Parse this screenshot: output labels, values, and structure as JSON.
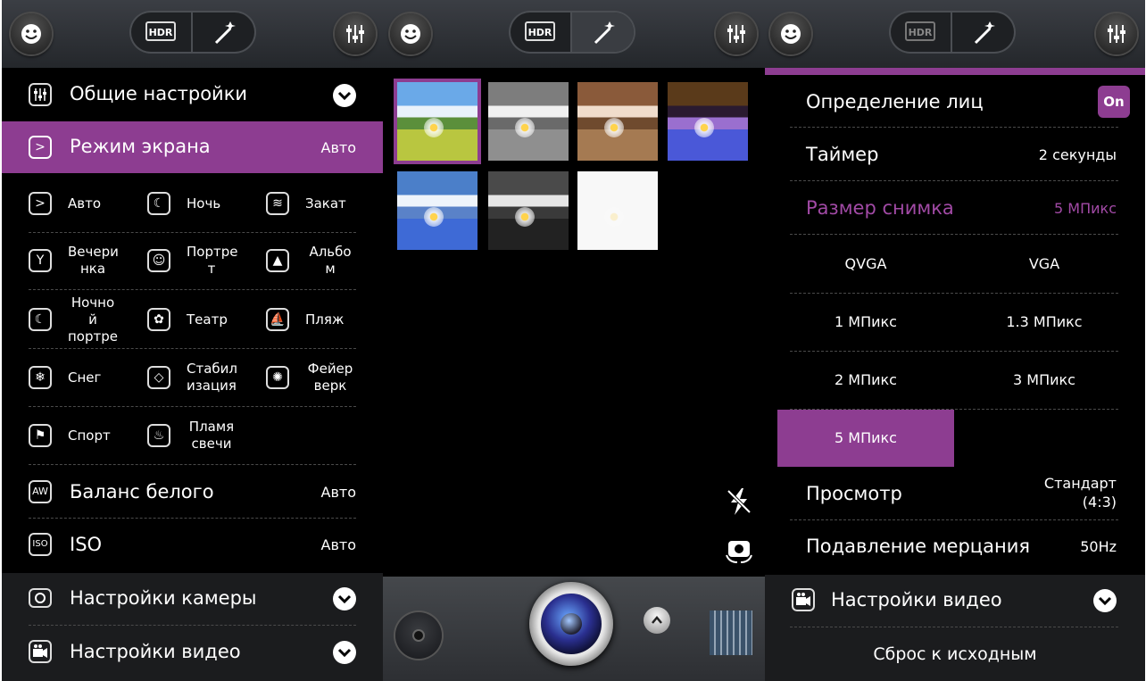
{
  "colors": {
    "accent": "#8d3d91",
    "background": "#000000",
    "topbar": "#2c2f33"
  },
  "topbar": {
    "hdr_label": "HDR",
    "left_icon": "smiley-icon",
    "magic_icon": "magic-wand-icon",
    "settings_icon": "sliders-icon"
  },
  "screen1": {
    "general_settings": "Общие настройки",
    "scene_mode": {
      "label": "Режим экрана",
      "value": "Авто"
    },
    "scenes": [
      {
        "label": "Авто",
        "icon": "auto-scene-icon"
      },
      {
        "label": "Ночь",
        "icon": "night-scene-icon"
      },
      {
        "label": "Закат",
        "icon": "sunset-scene-icon"
      },
      {
        "label": "Вечеринка",
        "icon": "party-scene-icon"
      },
      {
        "label": "Портрет",
        "icon": "portrait-scene-icon"
      },
      {
        "label": "Альбом",
        "icon": "album-scene-icon"
      },
      {
        "label": "Ночной портрет",
        "icon": "night-portrait-scene-icon"
      },
      {
        "label": "Театр",
        "icon": "theater-scene-icon"
      },
      {
        "label": "Пляж",
        "icon": "beach-scene-icon"
      },
      {
        "label": "Снег",
        "icon": "snow-scene-icon"
      },
      {
        "label": "Стабилизация",
        "icon": "stabilization-scene-icon"
      },
      {
        "label": "Фейерверк",
        "icon": "fireworks-scene-icon"
      },
      {
        "label": "Спорт",
        "icon": "sport-scene-icon"
      },
      {
        "label": "Пламя свечи",
        "icon": "candle-scene-icon"
      }
    ],
    "scene_lines": [
      [
        "Авто"
      ],
      [
        "Ночь"
      ],
      [
        "Закат"
      ],
      [
        "Вечери",
        "нка"
      ],
      [
        "Портре",
        "т"
      ],
      [
        "Альбо",
        "м"
      ],
      [
        "Ночно",
        "й",
        "портре"
      ],
      [
        "Театр"
      ],
      [
        "Пляж"
      ],
      [
        "Снег"
      ],
      [
        "Стабил",
        "изация"
      ],
      [
        "Фейер",
        "верк"
      ],
      [
        "Спорт"
      ],
      [
        "Пламя",
        "свечи"
      ]
    ],
    "white_balance": {
      "label": "Баланс белого",
      "value": "Авто"
    },
    "iso": {
      "label": "ISO",
      "value": "Авто"
    },
    "camera_settings": "Настройки камеры",
    "video_settings": "Настройки видео"
  },
  "screen2": {
    "effects": [
      "normal",
      "mono",
      "sepia",
      "negative",
      "aqua",
      "blackboard",
      "whiteboard"
    ],
    "selected_effect": 0
  },
  "screen3": {
    "face_detection": {
      "label": "Определение лиц",
      "value": "On"
    },
    "timer": {
      "label": "Таймер",
      "value": "2 секунды"
    },
    "picture_size": {
      "label": "Размер снимка",
      "value": "5 МПикс"
    },
    "sizes": [
      "QVGA",
      "VGA",
      "1 МПикс",
      "1.3 МПикс",
      "2 МПикс",
      "3 МПикс",
      "5 МПикс"
    ],
    "selected_size": 6,
    "review": {
      "label": "Просмотр",
      "value_line1": "Стандарт",
      "value_line2": "(4:3)"
    },
    "antibanding": {
      "label": "Подавление мерцания",
      "value": "50Hz"
    },
    "video_settings": "Настройки видео",
    "reset": "Сброс к исходным"
  }
}
